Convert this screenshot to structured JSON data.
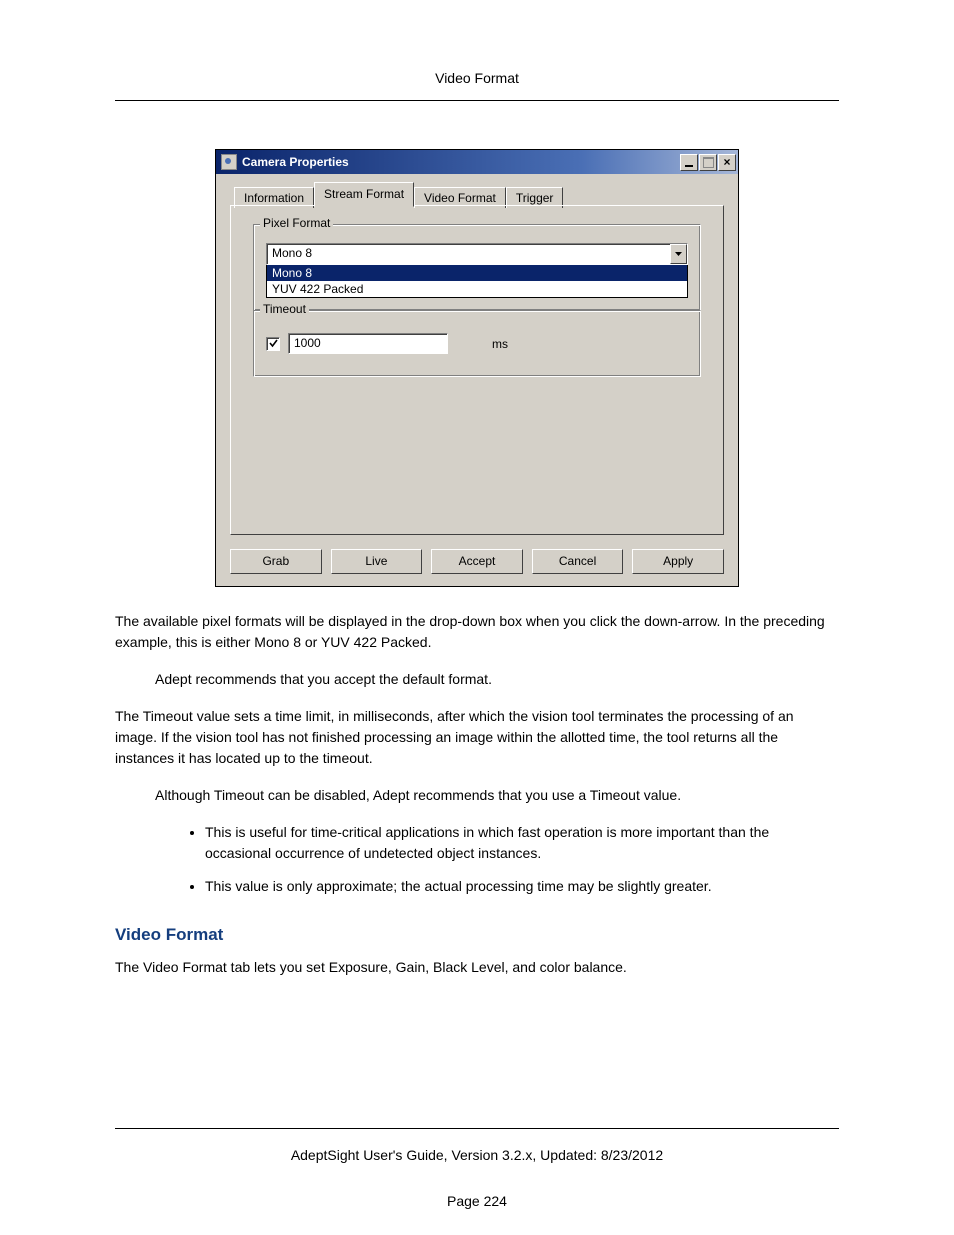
{
  "header": {
    "title": "Video Format"
  },
  "dialog": {
    "title": "Camera Properties",
    "tabs": [
      "Information",
      "Stream Format",
      "Video Format",
      "Trigger"
    ],
    "active_tab_index": 1,
    "pixel_format": {
      "label": "Pixel Format",
      "selected": "Mono 8",
      "options": [
        "Mono 8",
        "YUV 422 Packed"
      ]
    },
    "timeout": {
      "label": "Timeout",
      "enabled": true,
      "value": "1000",
      "unit": "ms"
    },
    "buttons": [
      "Grab",
      "Live",
      "Accept",
      "Cancel",
      "Apply"
    ]
  },
  "body": {
    "p1": "The available pixel formats will be displayed in the drop-down box when you click the down-arrow. In the preceding example, this is either Mono 8 or YUV 422 Packed.",
    "p2": "Adept recommends that you accept the default format.",
    "p3": "The Timeout value sets a time limit, in milliseconds, after which the vision tool terminates the processing of an image. If the vision tool has not finished processing an image within the allotted time, the tool returns all the instances it has located up to the timeout.",
    "p4": "Although Timeout can be disabled, Adept recommends that you use a Timeout value.",
    "bullets": [
      "This is useful for time-critical applications in which fast operation is more important than the occasional occurrence of undetected object instances.",
      "This value is only approximate; the actual processing time may be slightly greater."
    ],
    "h2": "Video Format",
    "p5": "The Video Format tab lets you set Exposure, Gain, Black Level, and color balance."
  },
  "footer": {
    "line": "AdeptSight User's Guide,  Version 3.2.x, Updated: 8/23/2012",
    "page": "Page 224"
  }
}
